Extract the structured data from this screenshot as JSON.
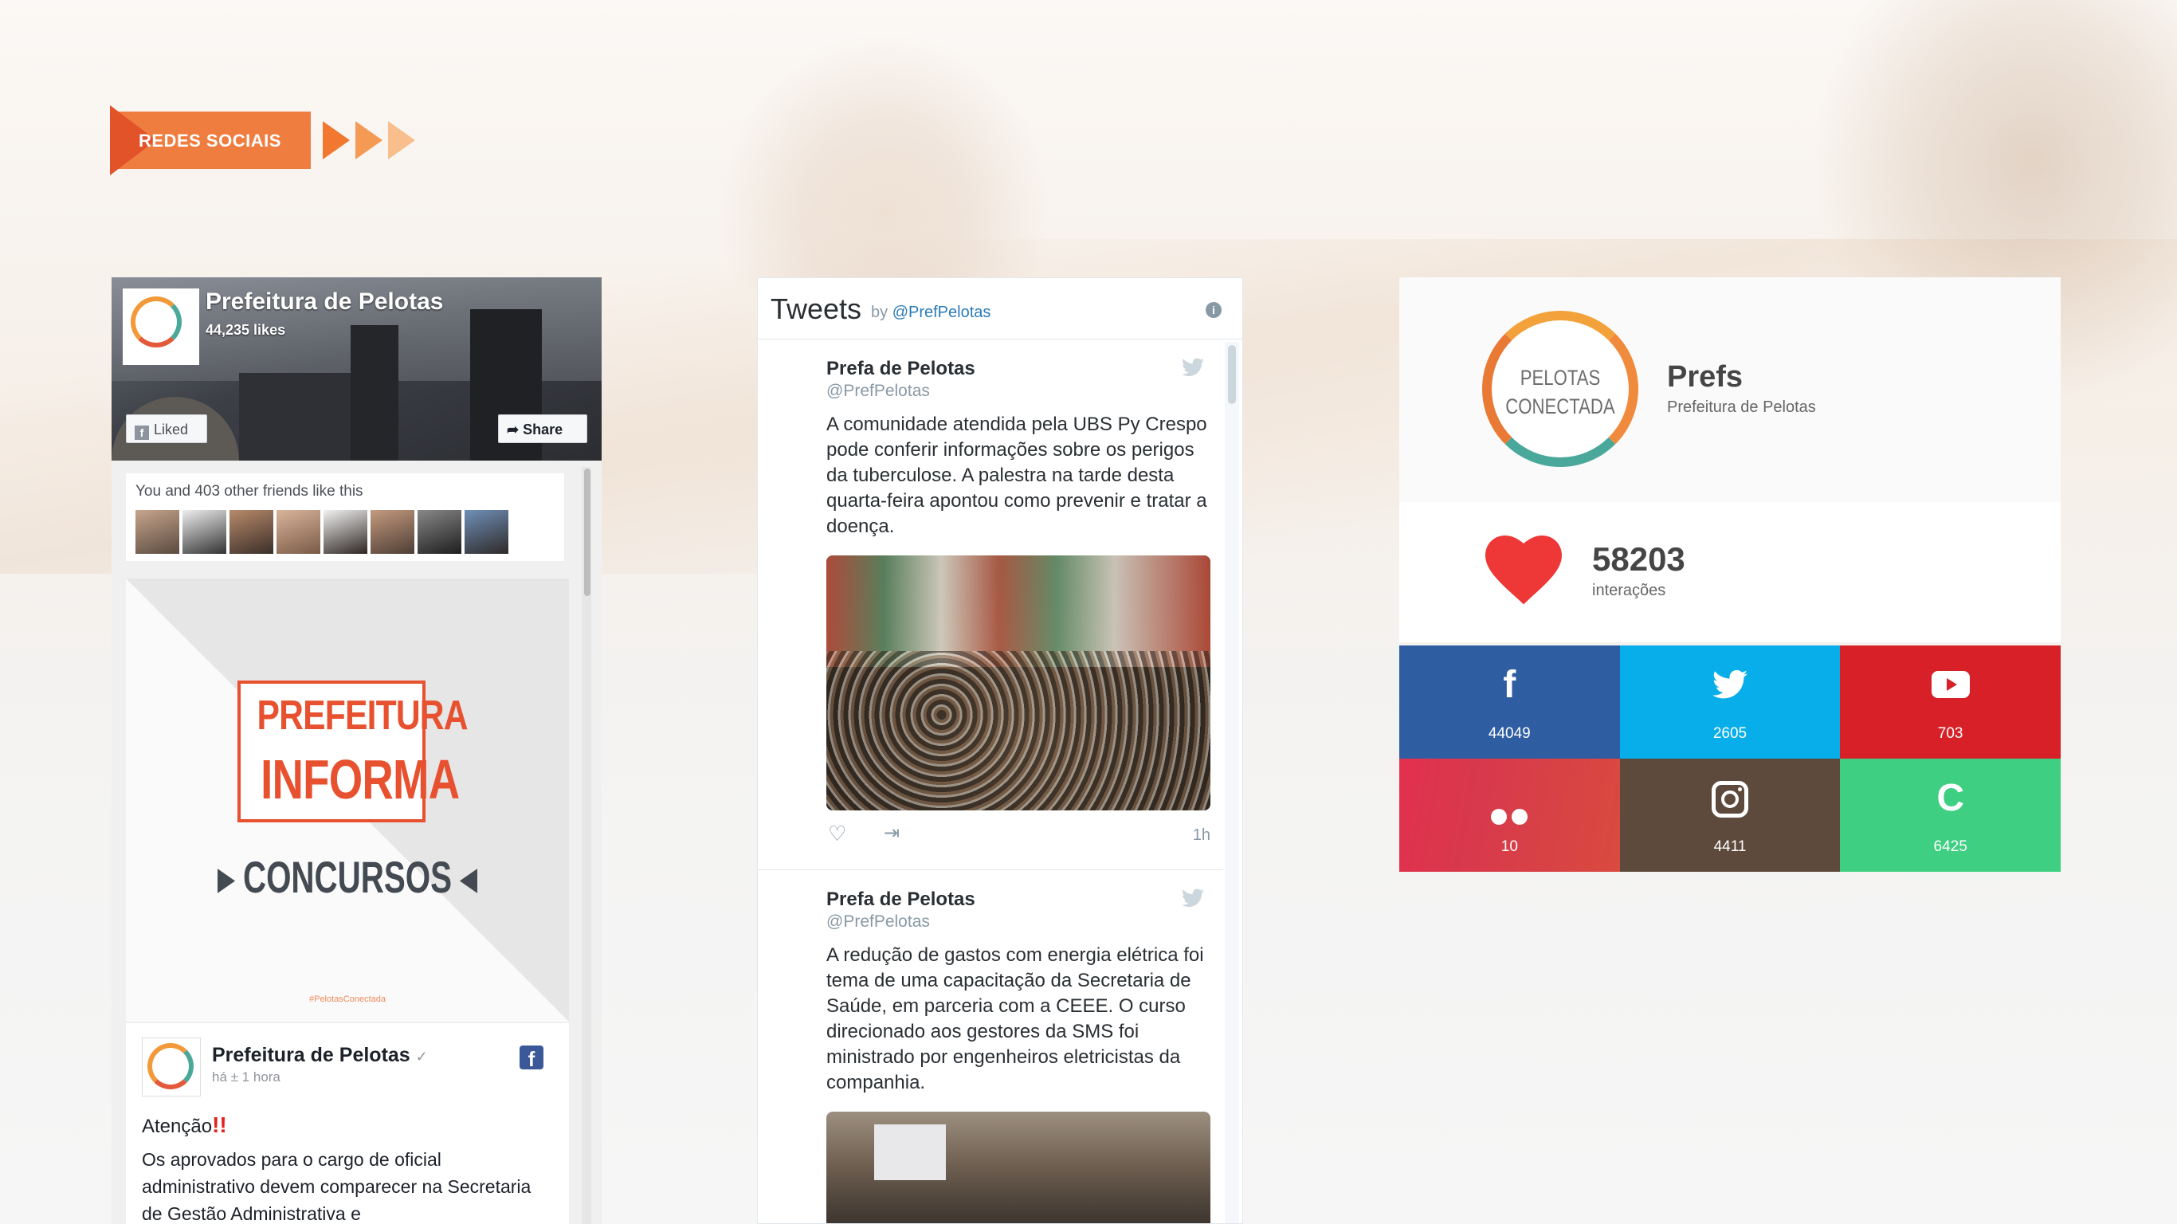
{
  "header": {
    "badge_label": "REDES SOCIAIS"
  },
  "facebook": {
    "page_name": "Prefeitura de Pelotas",
    "likes": "44,235 likes",
    "liked_label": "Liked",
    "share_label": "Share",
    "friends_text": "You and 403 other friends like this",
    "post_image": {
      "line1": "PREFEITURA",
      "line2": "INFORMA",
      "line3": "CONCURSOS",
      "hashtag": "#PelotasConectada"
    },
    "post": {
      "author": "Prefeitura de Pelotas",
      "time": "há ± 1 hora",
      "title": "Atenção",
      "body": "Os aprovados para o cargo de oficial administrativo devem comparecer na Secretaria de Gestão Administrativa e"
    }
  },
  "twitter": {
    "title": "Tweets",
    "by": "by",
    "handle": "@PrefPelotas",
    "tweets": [
      {
        "name": "Prefa de Pelotas",
        "handle": "@PrefPelotas",
        "text": "A comunidade atendida pela UBS Py Crespo pode conferir informações sobre os perigos da tuberculose. A palestra na tarde desta quarta-feira apontou como prevenir e tratar a doença.",
        "time": "1h"
      },
      {
        "name": "Prefa de Pelotas",
        "handle": "@PrefPelotas",
        "text": "A redução de gastos com energia elétrica foi tema de uma capacitação da Secretaria de Saúde, em parceria com a CEEE. O curso direcionado aos gestores da SMS foi ministrado por engenheiros eletricistas da companhia."
      }
    ]
  },
  "conectada": {
    "logo_line1": "PELOTAS",
    "logo_line2": "CONECTADA",
    "brand": "Prefs",
    "brand_sub": "Prefeitura de Pelotas",
    "interactions": "58203",
    "interactions_label": "interações",
    "networks": [
      {
        "icon": "facebook-icon",
        "glyph": "f",
        "count": "44049",
        "color": "#2f5da1"
      },
      {
        "icon": "twitter-icon",
        "count": "2605",
        "color": "#08aeea"
      },
      {
        "icon": "youtube-icon",
        "count": "703",
        "color": "#d72028"
      },
      {
        "icon": "flickr-icon",
        "count": "10",
        "color": "#e2304f"
      },
      {
        "icon": "instagram-icon",
        "count": "4411",
        "color": "#5e4a3d"
      },
      {
        "icon": "c-icon",
        "glyph": "C",
        "count": "6425",
        "color": "#3ecf82"
      }
    ]
  }
}
